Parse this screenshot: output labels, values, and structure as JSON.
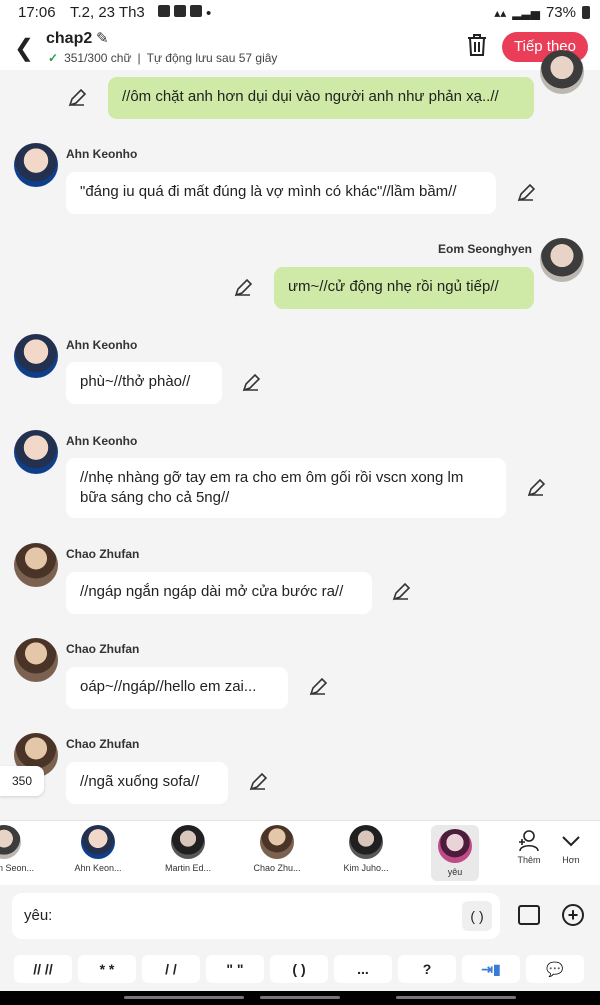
{
  "status": {
    "time": "17:06",
    "date": "T.2, 23 Th3",
    "battery": "73%"
  },
  "header": {
    "title": "chap2",
    "word_count": "351/300 chữ",
    "autosave": "Tự động lưu sau 57 giây",
    "next_label": "Tiếp theo",
    "accent": "#ea3e58"
  },
  "messages": [
    {
      "text": "//ôm chặt anh hơn dụi dụi vào người anh như phản xạ..//"
    },
    {
      "name": "Ahn Keonho",
      "text": "\"đáng iu quá đi mất đúng là vợ mình có khác\"//lầm bầm//"
    },
    {
      "name": "Eom Seonghyen",
      "text": "ưm~//cử động nhẹ rồi ngủ tiếp//"
    },
    {
      "name": "Ahn Keonho",
      "text": "phù~//thở phào//"
    },
    {
      "name": "Ahn Keonho",
      "text": "//nhẹ nhàng gỡ tay em ra cho em ôm gối rồi vscn xong lm bữa sáng cho cả 5ng//"
    },
    {
      "name": "Chao Zhufan",
      "text": "//ngáp ngắn ngáp dài mở cửa bước ra//"
    },
    {
      "name": "Chao Zhufan",
      "text": "oáp~//ngáp//hello em zai..."
    },
    {
      "name": "Chao Zhufan",
      "text": "//ngã xuống sofa//"
    }
  ],
  "counter": "350",
  "characters": [
    {
      "label": "Eom Seon..."
    },
    {
      "label": "Ahn Keon..."
    },
    {
      "label": "Martin Ed..."
    },
    {
      "label": "Chao Zhu..."
    },
    {
      "label": "Kim Juho..."
    },
    {
      "label": "yêu"
    }
  ],
  "more": {
    "add_label": "Thêm",
    "more_label": "Hơn"
  },
  "input": {
    "value": "yêu:",
    "paren": "( )"
  },
  "quick_keys": [
    "// //",
    "* *",
    "/ /",
    "\" \"",
    "( )",
    "...",
    "?"
  ]
}
